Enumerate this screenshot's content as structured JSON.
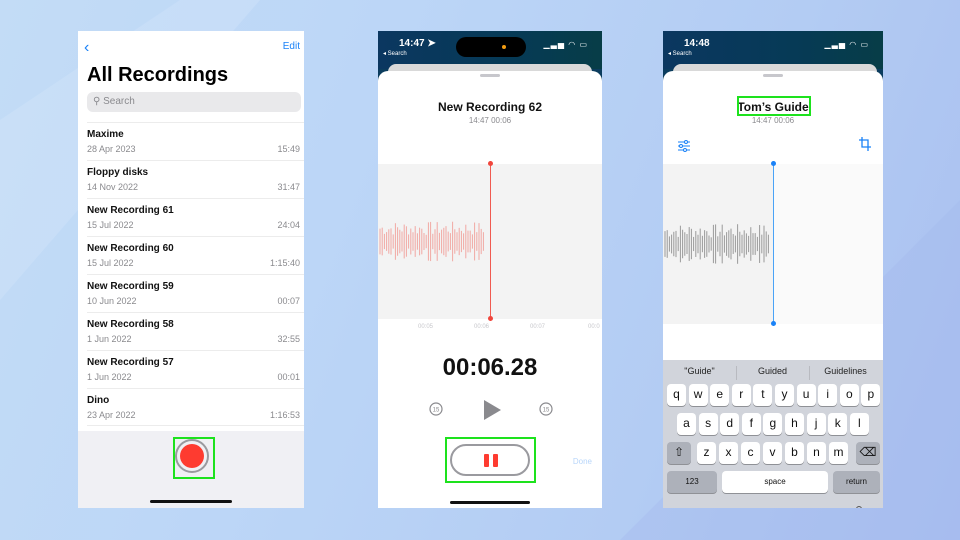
{
  "colors": {
    "accent": "#1a82f7",
    "record": "#fe3b30",
    "highlight": "#1de21d",
    "waveform_red": "#f1a8a3",
    "waveform_gray": "#9a9a9a",
    "playhead_blue": "#4aa3f7"
  },
  "panel1": {
    "back_icon": "chevron-left",
    "edit_label": "Edit",
    "title": "All Recordings",
    "search_placeholder": "Search",
    "recordings": [
      {
        "name": "Maxime",
        "date": "28 Apr 2023",
        "duration": "15:49"
      },
      {
        "name": "Floppy disks",
        "date": "14 Nov 2022",
        "duration": "31:47"
      },
      {
        "name": "New Recording 61",
        "date": "15 Jul 2022",
        "duration": "24:04"
      },
      {
        "name": "New Recording 60",
        "date": "15 Jul 2022",
        "duration": "1:15:40"
      },
      {
        "name": "New Recording 59",
        "date": "10 Jun 2022",
        "duration": "00:07"
      },
      {
        "name": "New Recording 58",
        "date": "1 Jun 2022",
        "duration": "32:55"
      },
      {
        "name": "New Recording 57",
        "date": "1 Jun 2022",
        "duration": "00:01"
      },
      {
        "name": "Dino",
        "date": "23 Apr 2022",
        "duration": "1:16:53"
      }
    ]
  },
  "panel2": {
    "status_time": "14:47",
    "status_back": "◂ Search",
    "title": "New Recording 62",
    "meta": "14:47  00:06",
    "ticks": [
      "00:05",
      "00:06",
      "00:07",
      "00:0"
    ],
    "elapsed": "00:06.28",
    "skip_back_label": "15",
    "skip_fwd_label": "15",
    "done_label": "Done"
  },
  "panel3": {
    "status_time": "14:48",
    "status_back": "◂ Search",
    "title": "Tom’s Guide",
    "meta": "14:47  00:06",
    "suggestions": [
      "\"Guide\"",
      "Guided",
      "Guidelines"
    ],
    "keyboard_rows": [
      [
        "q",
        "w",
        "e",
        "r",
        "t",
        "y",
        "u",
        "i",
        "o",
        "p"
      ],
      [
        "a",
        "s",
        "d",
        "f",
        "g",
        "h",
        "j",
        "k",
        "l"
      ],
      [
        "z",
        "x",
        "c",
        "v",
        "b",
        "n",
        "m"
      ]
    ],
    "numbers_key": "123",
    "space_key": "space",
    "return_key": "return"
  }
}
